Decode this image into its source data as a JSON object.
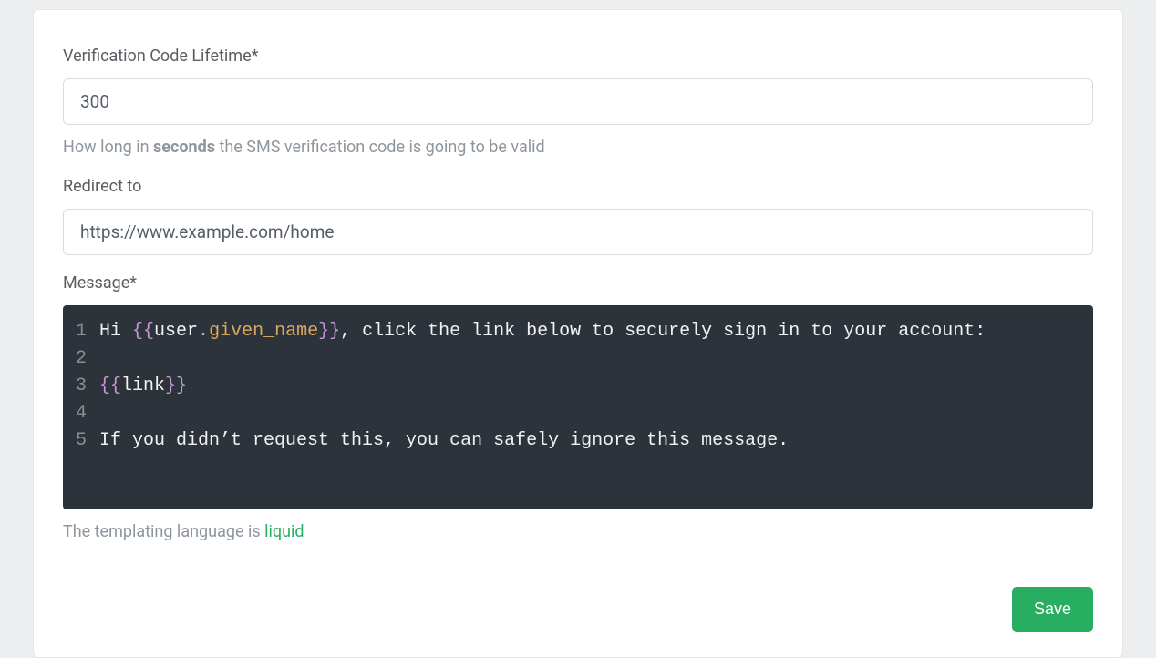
{
  "fields": {
    "lifetime": {
      "label": "Verification Code Lifetime*",
      "value": "300",
      "hint_pre": "How long in ",
      "hint_bold": "seconds",
      "hint_post": " the SMS verification code is going to be valid"
    },
    "redirect": {
      "label": "Redirect to",
      "value": "https://www.example.com/home"
    },
    "message": {
      "label": "Message*",
      "lines": [
        {
          "n": "1",
          "segments": [
            {
              "text": "Hi ",
              "cls": ""
            },
            {
              "text": "{{",
              "cls": "tok-brace"
            },
            {
              "text": "user",
              "cls": ""
            },
            {
              "text": ".",
              "cls": "tok-dot"
            },
            {
              "text": "given_name",
              "cls": "tok-prop"
            },
            {
              "text": "}}",
              "cls": "tok-brace"
            },
            {
              "text": ", click the link below to securely sign in to your account:",
              "cls": ""
            }
          ]
        },
        {
          "n": "2",
          "segments": []
        },
        {
          "n": "3",
          "segments": [
            {
              "text": "{{",
              "cls": "tok-brace"
            },
            {
              "text": "link",
              "cls": ""
            },
            {
              "text": "}}",
              "cls": "tok-brace"
            }
          ]
        },
        {
          "n": "4",
          "segments": []
        },
        {
          "n": "5",
          "segments": [
            {
              "text": "If you didn’t request this, you can safely ignore this message.",
              "cls": ""
            }
          ]
        }
      ],
      "hint_pre": "The templating language is ",
      "hint_link": "liquid"
    }
  },
  "actions": {
    "save": "Save"
  }
}
